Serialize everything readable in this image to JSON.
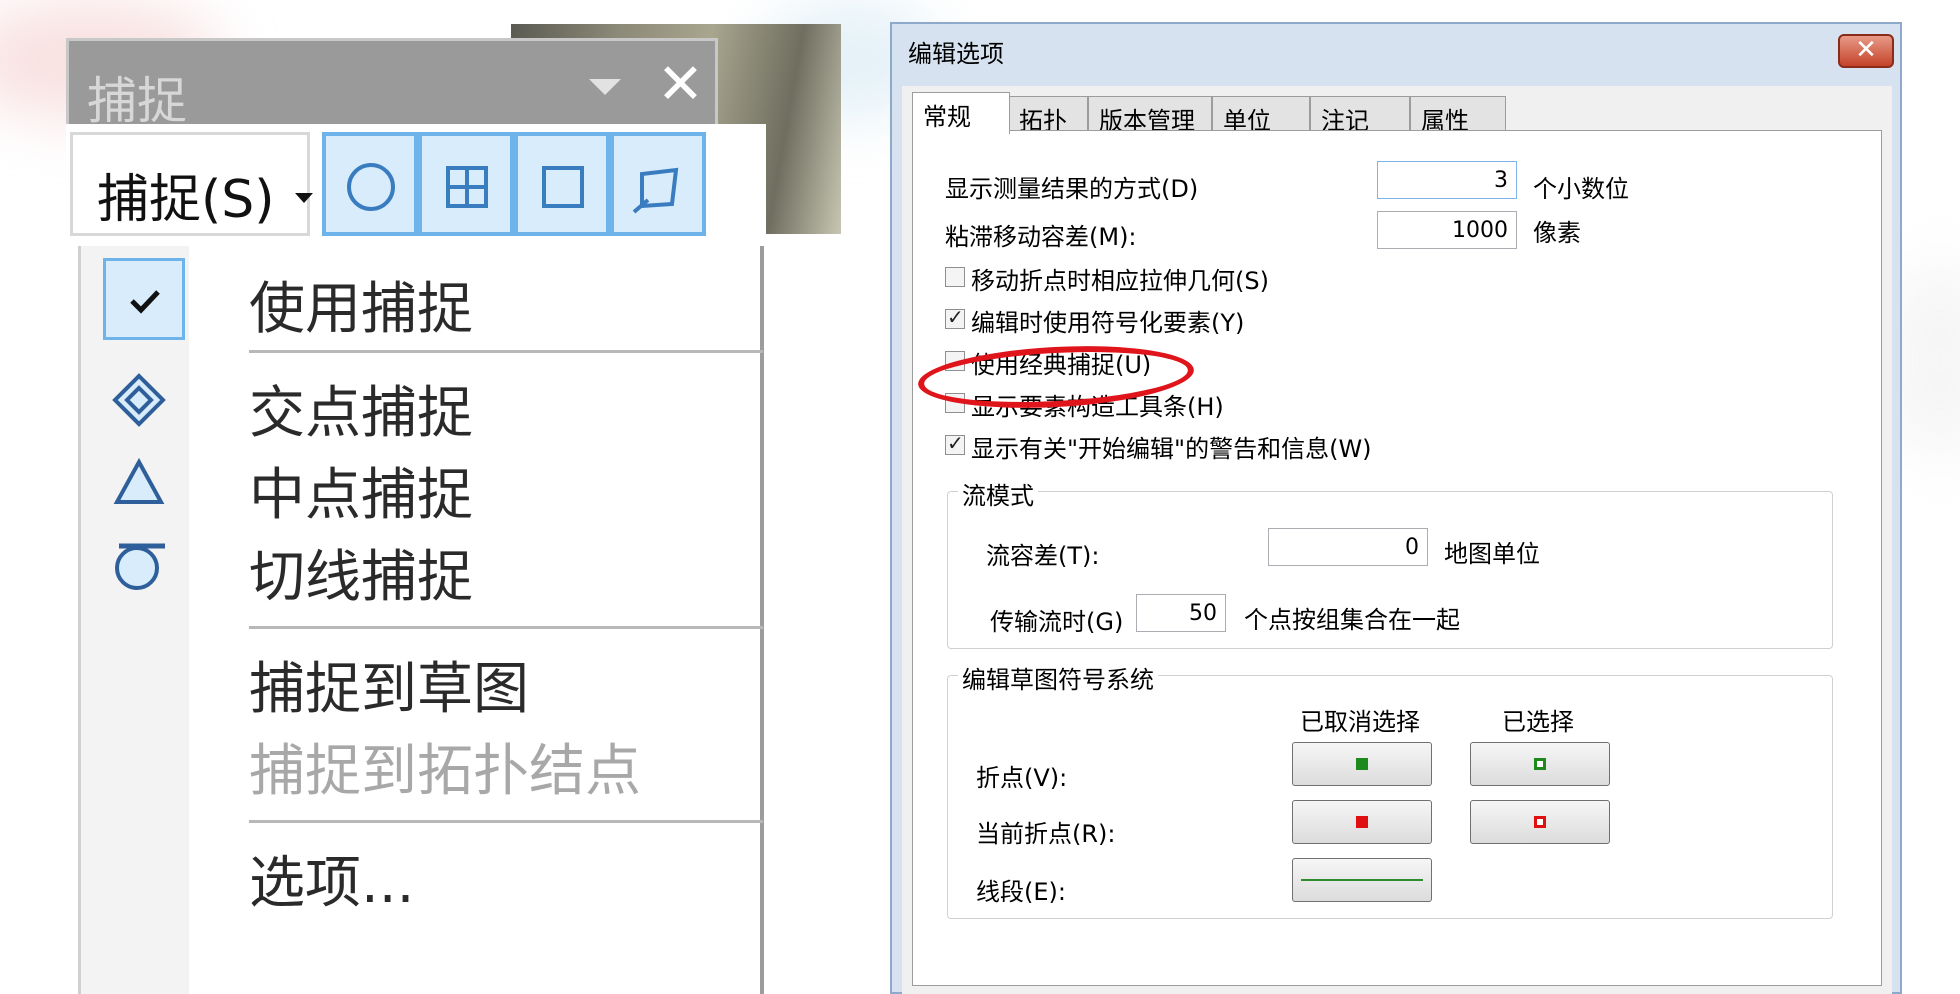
{
  "snap_toolbar": {
    "title": "捕捉",
    "menu_button_label": "捕捉(S)",
    "tools": [
      "point-snapping-icon",
      "edge-snapping-icon",
      "vertex-snapping-icon",
      "end-snapping-icon"
    ]
  },
  "snap_menu": {
    "items": [
      {
        "label": "使用捕捉",
        "icon": "checkmark-icon",
        "checked": true,
        "enabled": true
      },
      {
        "label": "交点捕捉",
        "icon": "intersection-snap-icon",
        "enabled": true
      },
      {
        "label": "中点捕捉",
        "icon": "midpoint-snap-icon",
        "enabled": true
      },
      {
        "label": "切线捕捉",
        "icon": "tangent-snap-icon",
        "enabled": true
      },
      {
        "label": "捕捉到草图",
        "enabled": true
      },
      {
        "label": "捕捉到拓扑结点",
        "enabled": false
      },
      {
        "label": "选项...",
        "enabled": true
      }
    ]
  },
  "dialog": {
    "title": "编辑选项",
    "tabs": [
      "常规",
      "拓扑",
      "版本管理",
      "单位",
      "注记",
      "属性"
    ],
    "active_tab": "常规",
    "general": {
      "measure_label": "显示测量结果的方式(D)",
      "measure_value": "3",
      "measure_unit": "个小数位",
      "sticky_label": "粘滞移动容差(M):",
      "sticky_value": "1000",
      "sticky_unit": "像素",
      "checkboxes": [
        {
          "label": "移动折点时相应拉伸几何(S)",
          "checked": false
        },
        {
          "label": "编辑时使用符号化要素(Y)",
          "checked": true
        },
        {
          "label": "使用经典捕捉(U)",
          "checked": false,
          "highlighted": true
        },
        {
          "label": "显示要素构造工具条(H)",
          "checked": false
        },
        {
          "label": "显示有关\"开始编辑\"的警告和信息(W)",
          "checked": true
        }
      ],
      "stream": {
        "title": "流模式",
        "tolerance_label": "流容差(T):",
        "tolerance_value": "0",
        "tolerance_unit": "地图单位",
        "group_label": "传输流时(G)",
        "group_value": "50",
        "group_unit": "个点按组集合在一起"
      },
      "sketch_symbology": {
        "title": "编辑草图符号系统",
        "col_unselected": "已取消选择",
        "col_selected": "已选择",
        "rows": [
          {
            "label": "折点(V):"
          },
          {
            "label": "当前折点(R):"
          },
          {
            "label": "线段(E):"
          }
        ]
      }
    }
  },
  "colors": {
    "highlight_ellipse": "#e0141b",
    "vertex_green": "#1e8a1e",
    "current_vertex_red": "#e01010",
    "segment_green": "#2e8b2e",
    "tool_blue": "#6eb4ea"
  }
}
